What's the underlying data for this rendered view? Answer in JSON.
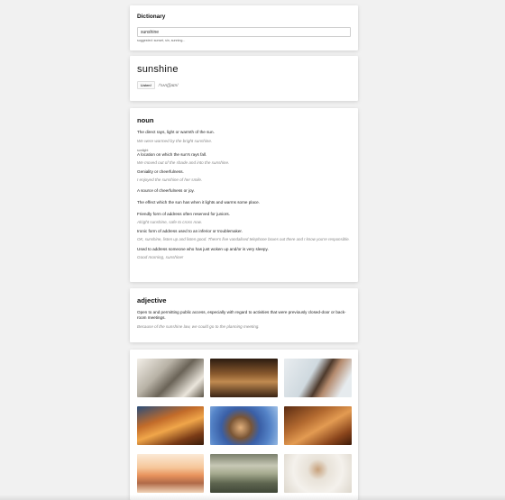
{
  "search": {
    "title": "Dictionary",
    "value": "sunshine",
    "placeholder": "",
    "suggestions": "suggested: sunset, sin, sunning..."
  },
  "entry": {
    "word": "sunshine",
    "listen_label": "Listen!",
    "phonetic": "/'sʌn(ʃ)aɪn/"
  },
  "noun": {
    "heading": "noun",
    "senses": [
      {
        "tag": "",
        "definition": "The direct rays, light or warmth of the sun.",
        "example": "We were warmed by the bright sunshine."
      },
      {
        "tag": "sunlight",
        "definition": "A location on which the sun's rays fall.",
        "example": "We moved out of the shade and into the sunshine."
      },
      {
        "tag": "",
        "definition": "Geniality or cheerfulness.",
        "example": "I enjoyed the sunshine of her smile."
      },
      {
        "tag": "",
        "definition": "A source of cheerfulness or joy.",
        "example": ""
      },
      {
        "tag": "",
        "definition": "The effect which the sun has when it lights and warms some place.",
        "example": ""
      },
      {
        "tag": "",
        "definition": "Friendly form of address often reserved for juniors.",
        "example": "Alright sunshine, safe to cross now."
      },
      {
        "tag": "",
        "definition": "Ironic form of address used to an inferior or troublemaker.",
        "example": "OK, sunshine, listen up and listen good. There's five vandalised telephone boxes out there and I know you're responsible."
      },
      {
        "tag": "",
        "definition": "Used to address someone who has just woken up and/or is very sleepy.",
        "example": "Good morning, sunshine!"
      }
    ]
  },
  "adjective": {
    "heading": "adjective",
    "definition": "Open to and permitting public access, especially with regard to activities that were previously closed-door or back-room meetings.",
    "example": "Because of the sunshine law, we could go to the planning meeting."
  },
  "gallery": {
    "photos": [
      "photo-palm-shadow",
      "photo-arch-silhouette",
      "photo-hair-flip",
      "photo-sunlit-face",
      "photo-sky-portrait",
      "photo-golden-hour",
      "photo-sunset-hills",
      "photo-misty-trees",
      "photo-beach-figure"
    ]
  }
}
